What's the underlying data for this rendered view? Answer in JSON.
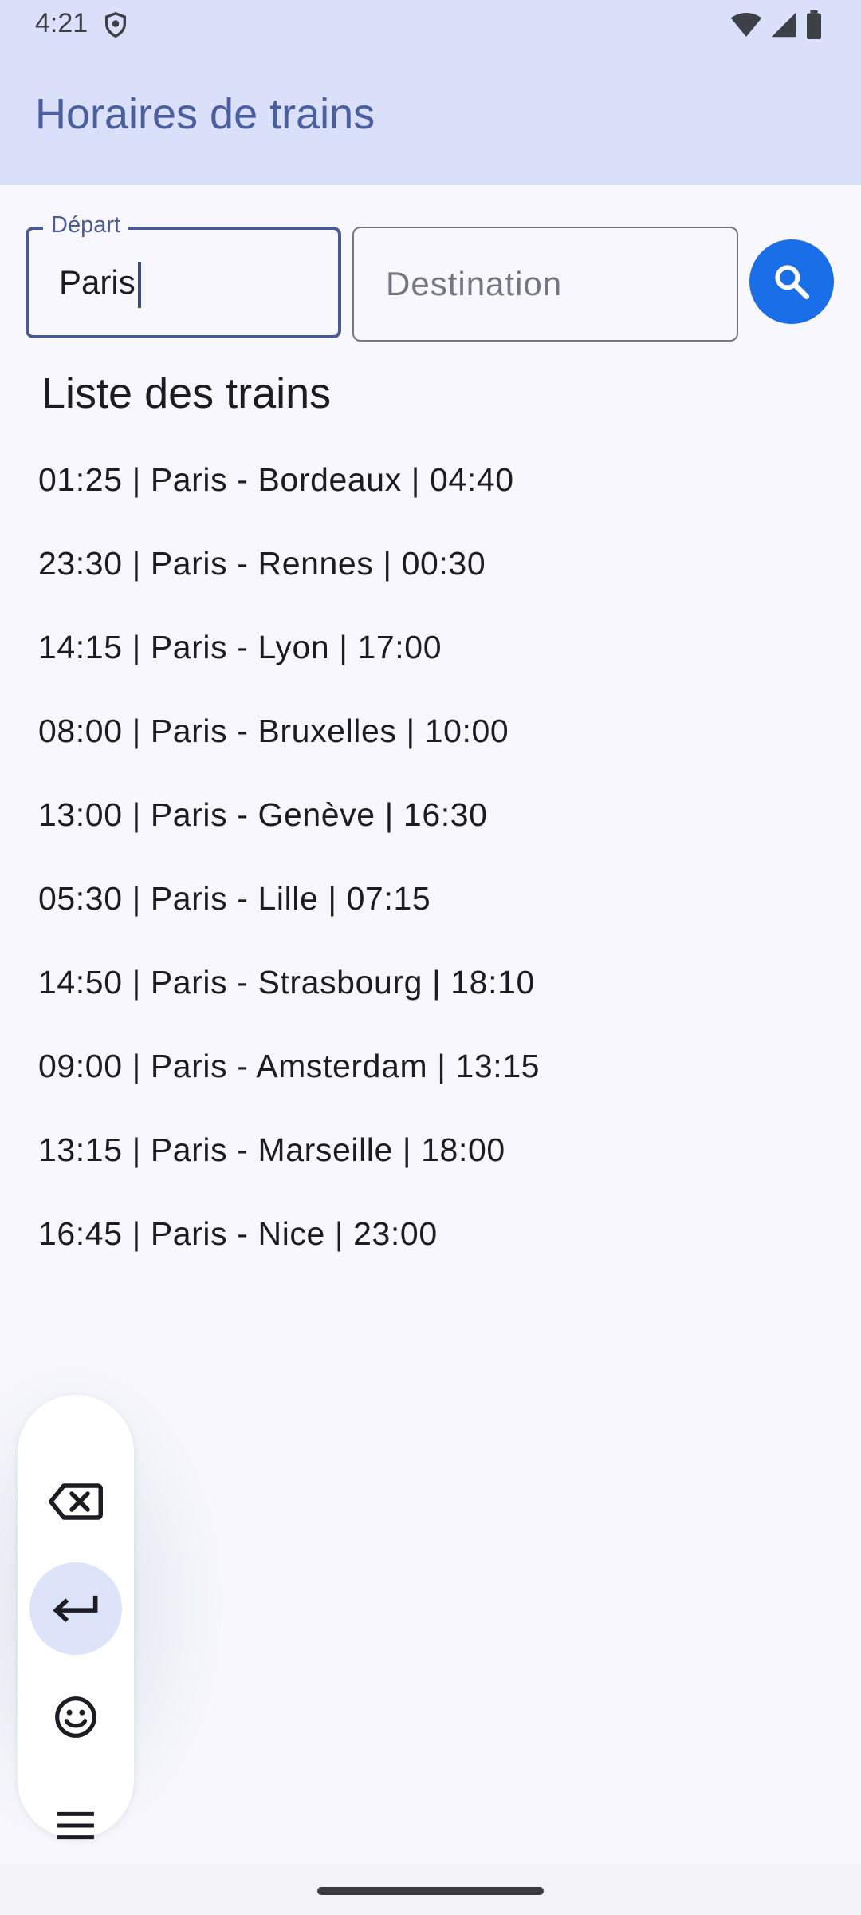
{
  "status_bar": {
    "time": "4:21",
    "icons": [
      "shield-icon",
      "wifi-icon",
      "signal-icon",
      "battery-icon"
    ]
  },
  "app_bar": {
    "title": "Horaires de trains"
  },
  "search": {
    "depart_label": "Départ",
    "depart_value": "Paris",
    "destination_placeholder": "Destination",
    "destination_value": "",
    "button_icon": "search-icon"
  },
  "list": {
    "title": "Liste des trains",
    "trains": [
      "01:25 | Paris - Bordeaux | 04:40",
      "23:30 | Paris - Rennes | 00:30",
      "14:15 | Paris - Lyon | 17:00",
      "08:00 | Paris - Bruxelles | 10:00",
      "13:00 | Paris - Genève | 16:30",
      "05:30 | Paris - Lille | 07:15",
      "14:50 | Paris - Strasbourg | 18:10",
      "09:00 | Paris - Amsterdam | 13:15",
      "13:15 | Paris - Marseille | 18:00",
      "16:45 | Paris - Nice | 23:00"
    ]
  },
  "keyboard_tools": {
    "items": [
      "backspace-icon",
      "enter-icon",
      "emoji-icon",
      "menu-icon"
    ],
    "active": "enter-icon"
  },
  "colors": {
    "app_bar": "#DBE0FA",
    "title": "#4A5EA0",
    "accent": "#1A6FE8",
    "background": "#F7F7FD"
  }
}
